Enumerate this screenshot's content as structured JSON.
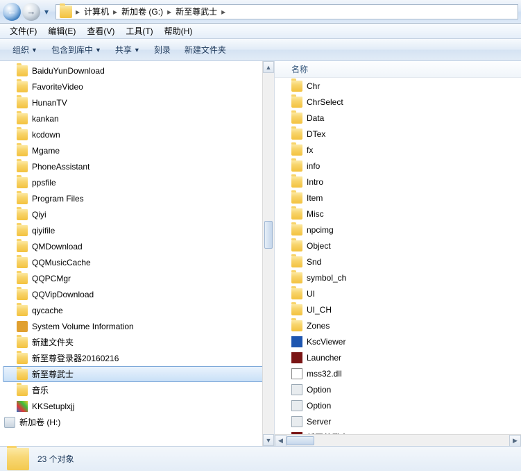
{
  "breadcrumb": [
    "计算机",
    "新加卷 (G:)",
    "新至尊武士"
  ],
  "menus": [
    "文件(F)",
    "编辑(E)",
    "查看(V)",
    "工具(T)",
    "帮助(H)"
  ],
  "commands": {
    "organize": "组织",
    "include": "包含到库中",
    "share": "共享",
    "burn": "刻录",
    "newfolder": "新建文件夹"
  },
  "column_name": "名称",
  "tree": [
    {
      "label": "BaiduYunDownload",
      "icon": "folder"
    },
    {
      "label": "FavoriteVideo",
      "icon": "folder"
    },
    {
      "label": "HunanTV",
      "icon": "folder"
    },
    {
      "label": "kankan",
      "icon": "folder"
    },
    {
      "label": "kcdown",
      "icon": "folder"
    },
    {
      "label": "Mgame",
      "icon": "folder"
    },
    {
      "label": "PhoneAssistant",
      "icon": "folder"
    },
    {
      "label": "ppsfile",
      "icon": "folder"
    },
    {
      "label": "Program Files",
      "icon": "folder"
    },
    {
      "label": "Qiyi",
      "icon": "folder"
    },
    {
      "label": "qiyifile",
      "icon": "folder"
    },
    {
      "label": "QMDownload",
      "icon": "folder"
    },
    {
      "label": "QQMusicCache",
      "icon": "folder"
    },
    {
      "label": "QQPCMgr",
      "icon": "folder"
    },
    {
      "label": "QQVipDownload",
      "icon": "folder"
    },
    {
      "label": "qycache",
      "icon": "folder"
    },
    {
      "label": "System Volume Information",
      "icon": "lock"
    },
    {
      "label": "新建文件夹",
      "icon": "folder"
    },
    {
      "label": "新至尊登录器20160216",
      "icon": "folder"
    },
    {
      "label": "新至尊武士",
      "icon": "folder",
      "selected": true
    },
    {
      "label": "音乐",
      "icon": "folder"
    },
    {
      "label": "KKSetuplxjj",
      "icon": "app1"
    },
    {
      "label": "新加卷 (H:)",
      "icon": "drive",
      "outdent": true
    }
  ],
  "files": [
    {
      "label": "Chr",
      "icon": "folder"
    },
    {
      "label": "ChrSelect",
      "icon": "folder"
    },
    {
      "label": "Data",
      "icon": "folder"
    },
    {
      "label": "DTex",
      "icon": "folder"
    },
    {
      "label": "fx",
      "icon": "folder"
    },
    {
      "label": "info",
      "icon": "folder"
    },
    {
      "label": "Intro",
      "icon": "folder"
    },
    {
      "label": "Item",
      "icon": "folder"
    },
    {
      "label": "Misc",
      "icon": "folder"
    },
    {
      "label": "npcimg",
      "icon": "folder"
    },
    {
      "label": "Object",
      "icon": "folder"
    },
    {
      "label": "Snd",
      "icon": "folder"
    },
    {
      "label": "symbol_ch",
      "icon": "folder"
    },
    {
      "label": "UI",
      "icon": "folder"
    },
    {
      "label": "UI_CH",
      "icon": "folder"
    },
    {
      "label": "Zones",
      "icon": "folder"
    },
    {
      "label": "KscViewer",
      "icon": "app2"
    },
    {
      "label": "Launcher",
      "icon": "app3"
    },
    {
      "label": "mss32.dll",
      "icon": "app4"
    },
    {
      "label": "Option",
      "icon": "app5"
    },
    {
      "label": "Option",
      "icon": "app5"
    },
    {
      "label": "Server",
      "icon": "app5"
    },
    {
      "label": "新至尊武士",
      "icon": "app3"
    }
  ],
  "status": "23 个对象"
}
